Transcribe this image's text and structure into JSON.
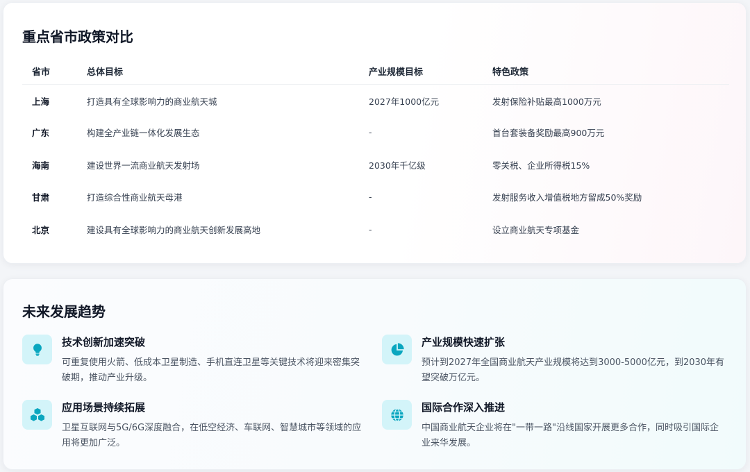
{
  "policy": {
    "title": "重点省市政策对比",
    "headers": [
      "省市",
      "总体目标",
      "产业规模目标",
      "特色政策"
    ],
    "rows": [
      [
        "上海",
        "打造具有全球影响力的商业航天城",
        "2027年1000亿元",
        "发射保险补贴最高1000万元"
      ],
      [
        "广东",
        "构建全产业链一体化发展生态",
        "-",
        "首台套装备奖励最高900万元"
      ],
      [
        "海南",
        "建设世界一流商业航天发射场",
        "2030年千亿级",
        "零关税、企业所得税15%"
      ],
      [
        "甘肃",
        "打造综合性商业航天母港",
        "-",
        "发射服务收入增值税地方留成50%奖励"
      ],
      [
        "北京",
        "建设具有全球影响力的商业航天创新发展高地",
        "-",
        "设立商业航天专项基金"
      ]
    ]
  },
  "trends": {
    "title": "未来发展趋势",
    "accent": "#0aa6bf",
    "icon_bg": "#d3f4f9",
    "items": [
      {
        "icon": "lightbulb-icon",
        "title": "技术创新加速突破",
        "desc": "可重复使用火箭、低成本卫星制造、手机直连卫星等关键技术将迎来密集突破期，推动产业升级。"
      },
      {
        "icon": "pie-chart-icon",
        "title": "产业规模快速扩张",
        "desc": "预计到2027年全国商业航天产业规模将达到3000-5000亿元，到2030年有望突破万亿元。"
      },
      {
        "icon": "cubes-icon",
        "title": "应用场景持续拓展",
        "desc": "卫星互联网与5G/6G深度融合，在低空经济、车联网、智慧城市等领域的应用将更加广泛。"
      },
      {
        "icon": "globe-icon",
        "title": "国际合作深入推进",
        "desc": "中国商业航天企业将在\"一带一路\"沿线国家开展更多合作，同时吸引国际企业来华发展。"
      }
    ]
  }
}
